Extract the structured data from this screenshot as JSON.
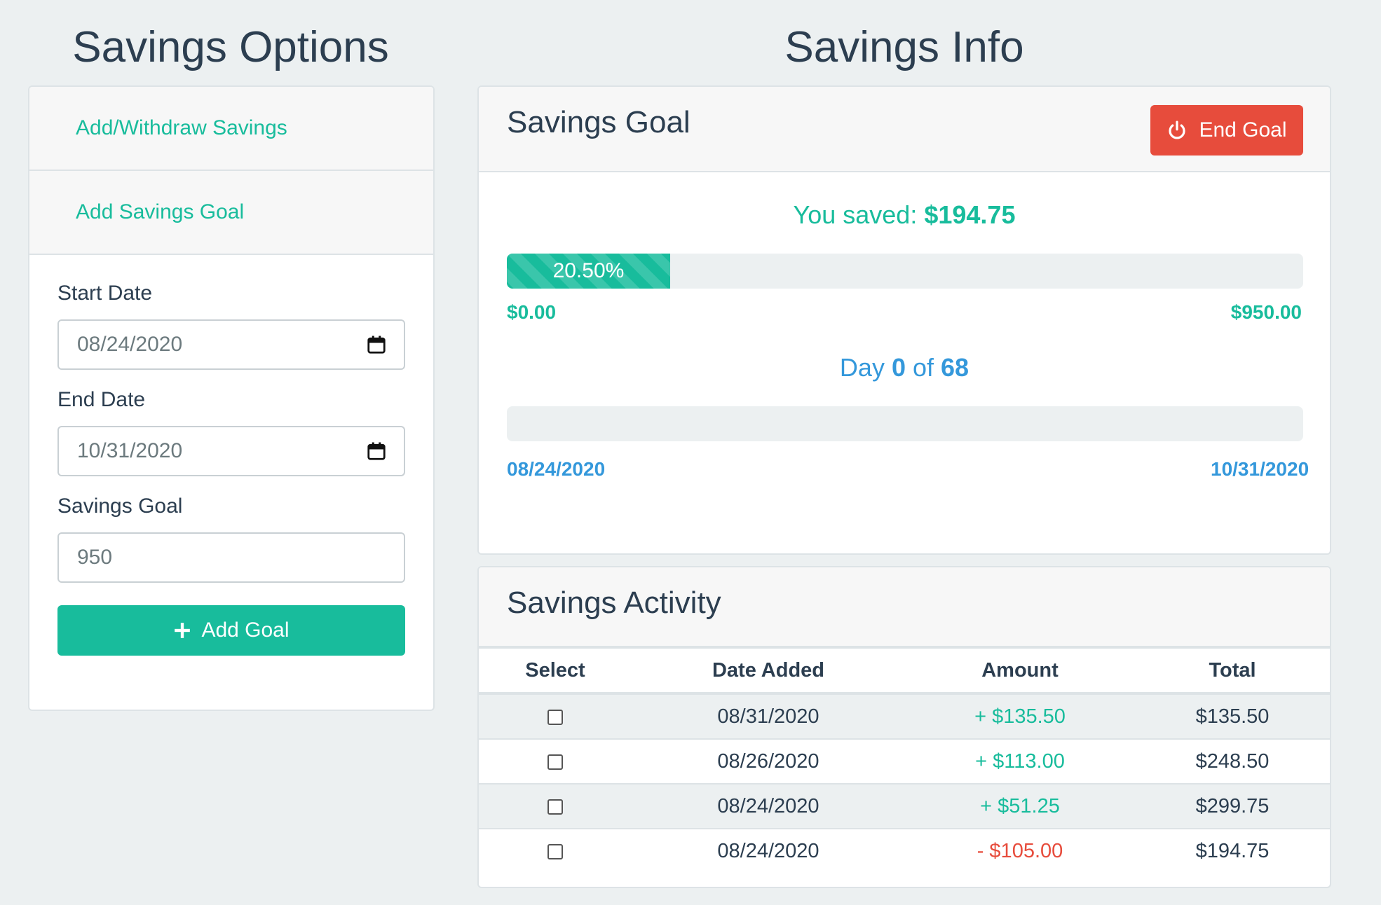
{
  "options": {
    "heading": "Savings Options",
    "menu": [
      "Add/Withdraw Savings",
      "Add Savings Goal"
    ],
    "form": {
      "start_label": "Start Date",
      "start_value": "08/24/2020",
      "end_label": "End Date",
      "end_value": "10/31/2020",
      "goal_label": "Savings Goal",
      "goal_value": "950",
      "add_button": "Add Goal"
    }
  },
  "info": {
    "heading": "Savings Info",
    "goal": {
      "title": "Savings Goal",
      "end_button": "End Goal",
      "saved_prefix": "You saved: ",
      "saved_amount": "$194.75",
      "progress_percent": 20.5,
      "progress_label": "20.50%",
      "min_amount": "$0.00",
      "max_amount": "$950.00",
      "day_prefix": "Day ",
      "day_current": "0",
      "day_of": " of ",
      "day_total": "68",
      "days_progress_percent": 0,
      "start_date": "08/24/2020",
      "end_date": "10/31/2020"
    },
    "activity": {
      "title": "Savings Activity",
      "columns": [
        "Select",
        "Date Added",
        "Amount",
        "Total"
      ],
      "rows": [
        {
          "date": "08/31/2020",
          "amount": "+ $135.50",
          "total": "$135.50",
          "sign": "pos"
        },
        {
          "date": "08/26/2020",
          "amount": "+ $113.00",
          "total": "$248.50",
          "sign": "pos"
        },
        {
          "date": "08/24/2020",
          "amount": "+ $51.25",
          "total": "$299.75",
          "sign": "pos"
        },
        {
          "date": "08/24/2020",
          "amount": "- $105.00",
          "total": "$194.75",
          "sign": "neg"
        }
      ]
    }
  },
  "colors": {
    "success": "#18bc9c",
    "danger": "#e74c3c",
    "info": "#3498db",
    "text": "#2c3e50"
  },
  "icons": {
    "date": "calendar-icon",
    "add": "plus-icon",
    "end": "power-icon"
  }
}
